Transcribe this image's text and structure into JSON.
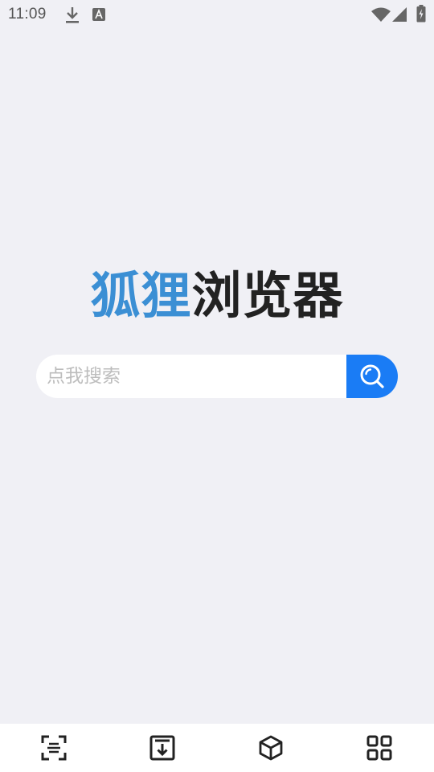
{
  "status_bar": {
    "time": "11:09",
    "icons": [
      "download-icon",
      "text-a-icon",
      "wifi-icon",
      "signal-icon",
      "battery-icon"
    ]
  },
  "logo": {
    "part_blue": "狐狸",
    "part_dark": "浏览器",
    "colors": {
      "blue": "#3b8fd4",
      "dark": "#222222"
    }
  },
  "search": {
    "placeholder": "点我搜索",
    "value": "",
    "button_icon": "search-icon",
    "button_color": "#1a7cf5"
  },
  "bottom_nav": {
    "items": [
      {
        "icon": "scan-icon"
      },
      {
        "icon": "download-tray-icon"
      },
      {
        "icon": "box-3d-icon"
      },
      {
        "icon": "grid-menu-icon"
      }
    ]
  },
  "colors": {
    "background": "#f0f0f5",
    "accent": "#1a7cf5"
  }
}
